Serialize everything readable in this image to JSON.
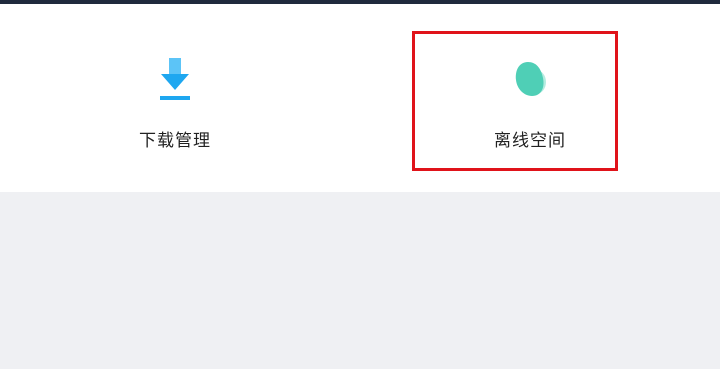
{
  "window": {
    "topbar_color": "#1f2a3d",
    "panel_background": "#ffffff",
    "page_background": "#eff0f3"
  },
  "tiles": [
    {
      "label": "下载管理",
      "icon": "download-arrow-icon",
      "icon_color": "#1ea7f0"
    },
    {
      "label": "离线空间",
      "icon": "offline-space-icon",
      "icon_color": "#4fcfb6"
    }
  ],
  "highlight": {
    "target": "离线空间",
    "color": "#e0131a"
  }
}
